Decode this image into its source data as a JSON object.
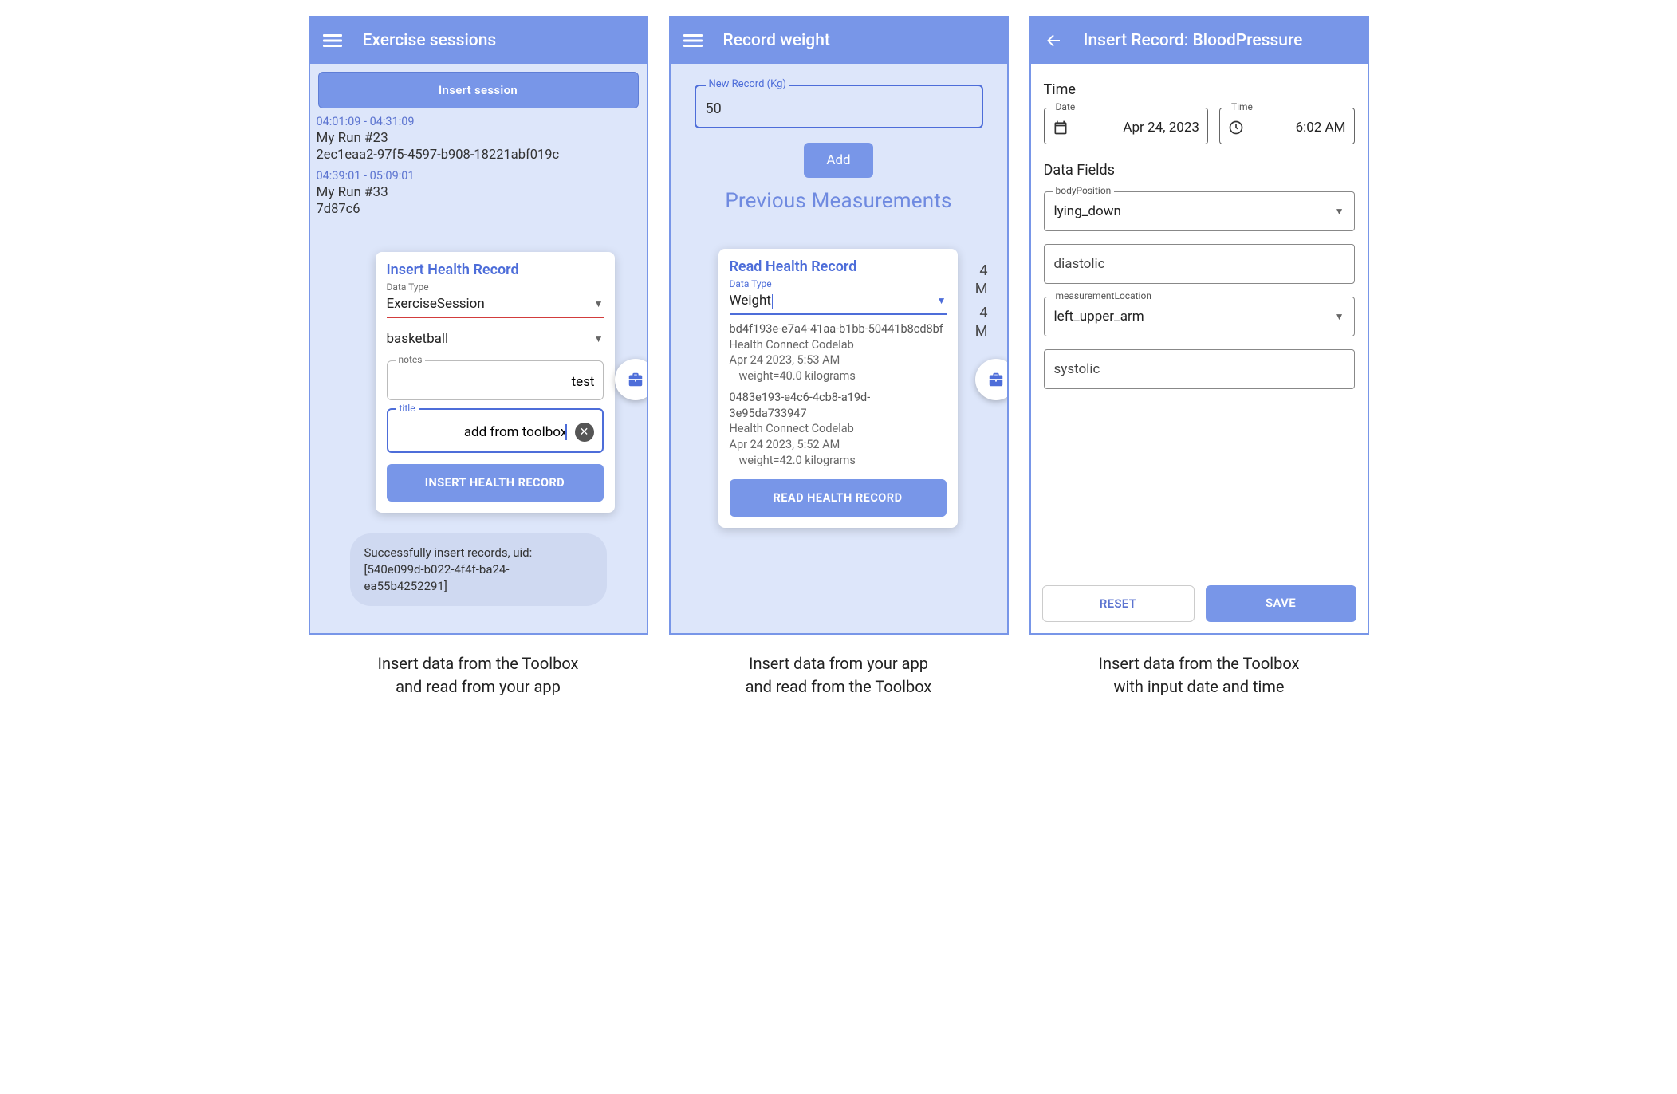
{
  "phone1": {
    "appbar": "Exercise sessions",
    "insert_session": "Insert session",
    "entries": [
      {
        "ts": "04:01:09 - 04:31:09",
        "name": "My Run #23",
        "uuid": "2ec1eaa2-97f5-4597-b908-18221abf019c"
      },
      {
        "ts": "04:39:01 - 05:09:01",
        "name": "My Run #33",
        "uuid": "7d87c6"
      }
    ],
    "toast_l1": "Successfully insert records, uid:",
    "toast_l2": "[540e099d-b022-4f4f-ba24-ea55b4252291]",
    "overlay": {
      "title": "Insert Health Record",
      "data_type_label": "Data Type",
      "data_type_val": "ExerciseSession",
      "type_val": "basketball",
      "notes_label": "notes",
      "notes_val": "test",
      "title_label": "title",
      "title_val": "add from toolbox",
      "button": "INSERT HEALTH RECORD"
    },
    "caption_l1": "Insert data from the Toolbox",
    "caption_l2": "and read from your app"
  },
  "phone2": {
    "appbar": "Record weight",
    "rec_label": "New Record (Kg)",
    "rec_val": "50",
    "add": "Add",
    "prev_hdr": "Previous Measurements",
    "side_nums": [
      "4",
      "M",
      "4",
      "M"
    ],
    "overlay": {
      "title": "Read Health Record",
      "data_type_label": "Data Type",
      "data_type_val": "Weight",
      "items": [
        {
          "id": "bd4f193e-e7a4-41aa-b1bb-50441b8cd8bf",
          "src": "Health Connect Codelab",
          "ts": "Apr 24 2023, 5:53 AM",
          "w": "weight=40.0 kilograms"
        },
        {
          "id": "0483e193-e4c6-4cb8-a19d-3e95da733947",
          "src": "Health Connect Codelab",
          "ts": "Apr 24 2023, 5:52 AM",
          "w": "weight=42.0 kilograms"
        }
      ],
      "button": "READ HEALTH RECORD"
    },
    "caption_l1": "Insert data from your app",
    "caption_l2": "and read from the Toolbox"
  },
  "phone3": {
    "appbar": "Insert Record: BloodPressure",
    "time_hdr": "Time",
    "date_label": "Date",
    "date_val": "Apr 24, 2023",
    "time_label": "Time",
    "time_val": "6:02 AM",
    "fields_hdr": "Data Fields",
    "body_pos_label": "bodyPosition",
    "body_pos_val": "lying_down",
    "diastolic_label": "diastolic",
    "meas_label": "measurementLocation",
    "meas_val": "left_upper_arm",
    "systolic_label": "systolic",
    "reset": "RESET",
    "save": "SAVE",
    "caption_l1": "Insert data from the Toolbox",
    "caption_l2": "with input date and time"
  }
}
